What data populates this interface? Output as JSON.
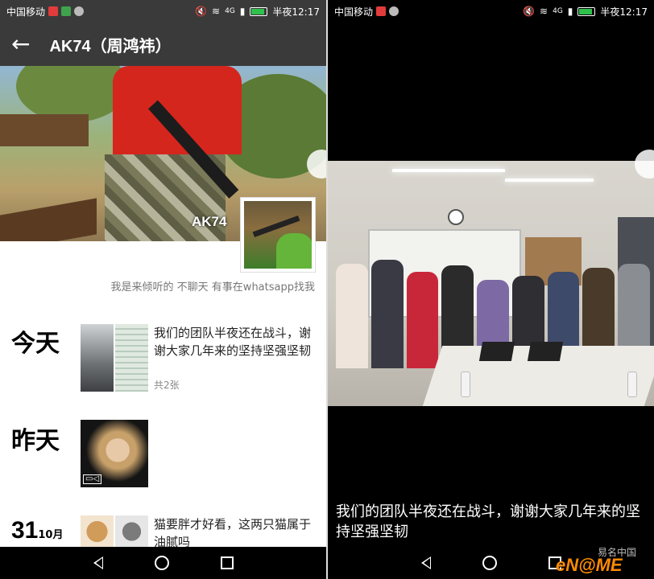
{
  "status_bar": {
    "carrier": "中国移动",
    "network": "4G",
    "time": "半夜12:17"
  },
  "profile": {
    "title": "AK74（周鸿祎）",
    "cover_name": "AK74",
    "signature": "我是来倾听的 不聊天 有事在whatsapp找我"
  },
  "timeline": [
    {
      "label": "今天",
      "text": "我们的团队半夜还在战斗，谢谢大家几年来的坚持坚强坚韧",
      "count": "共2张"
    },
    {
      "label": "昨天",
      "media": "video"
    },
    {
      "day": "31",
      "month": "10月",
      "text": "猫要胖才好看，这两只猫属于油腻吗"
    }
  ],
  "viewer": {
    "caption": "我们的团队半夜还在战斗，谢谢大家几年来的坚持坚强坚韧"
  },
  "watermark": {
    "text": "易名中国",
    "logo": "eN@ME"
  },
  "icons": {
    "back": "back-arrow-icon",
    "wifi": "wifi-icon",
    "battery": "battery-icon",
    "nav_back": "nav-back-icon",
    "nav_home": "nav-home-icon",
    "nav_recent": "nav-recent-icon"
  },
  "colors": {
    "appbar": "#3a3a3a",
    "battery": "#2ec14b",
    "watermark": "#ff8a00"
  }
}
